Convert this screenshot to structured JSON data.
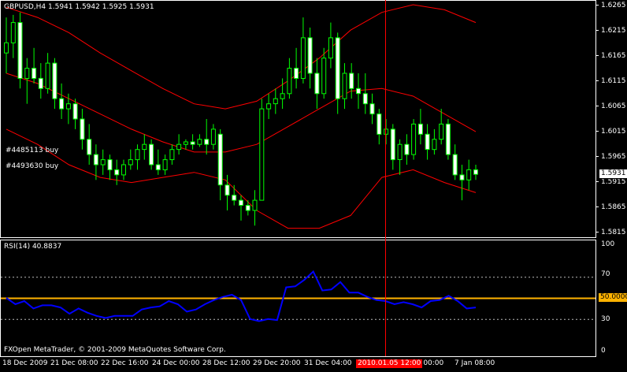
{
  "main_chart": {
    "header": "GBPUSD,H4  1.5941 1.5942 1.5925 1.5931",
    "orders": [
      "#4485113 buy",
      "#4493630 buy"
    ],
    "price_axis": [
      "1.6265",
      "1.6215",
      "1.6165",
      "1.6115",
      "1.6065",
      "1.6015",
      "1.5965",
      "1.5915",
      "1.5865",
      "1.5815"
    ],
    "current_price": "1.5931"
  },
  "rsi_panel": {
    "label": "RSI(14) 40.8837",
    "axis": [
      "100",
      "70",
      "30",
      "0"
    ],
    "level_value": "50.0000",
    "copyright": "FXOpen MetaTrader, © 2001-2009 MetaQuotes Software Corp."
  },
  "time_axis": {
    "labels": [
      "18 Dec 2009",
      "21 Dec 08:00",
      "22 Dec 16:00",
      "24 Dec 00:00",
      "28 Dec 12:00",
      "29 Dec 20:00",
      "31 Dec 04:00",
      "5 Jan 00:00",
      "7 Jan 08:00"
    ],
    "crosshair_time": "2010.01.05 12:00"
  },
  "colors": {
    "background": "#000000",
    "bull_candle": "#ffffff",
    "bear_candle": "#ffffff",
    "wick": "#00ff00",
    "bollinger": "#ff0000",
    "rsi_line": "#0000ff",
    "rsi_level": "#ffb300",
    "crosshair": "#ff0000",
    "axis": "#ffffff"
  },
  "chart_data": {
    "type": "candlestick",
    "symbol": "GBPUSD",
    "timeframe": "H4",
    "price_range": [
      1.5815,
      1.6265
    ],
    "candles": [
      {
        "o": 1.617,
        "h": 1.624,
        "l": 1.613,
        "c": 1.619
      },
      {
        "o": 1.619,
        "h": 1.6245,
        "l": 1.616,
        "c": 1.623
      },
      {
        "o": 1.623,
        "h": 1.625,
        "l": 1.61,
        "c": 1.612
      },
      {
        "o": 1.612,
        "h": 1.616,
        "l": 1.607,
        "c": 1.614
      },
      {
        "o": 1.614,
        "h": 1.618,
        "l": 1.611,
        "c": 1.612
      },
      {
        "o": 1.612,
        "h": 1.615,
        "l": 1.608,
        "c": 1.61
      },
      {
        "o": 1.61,
        "h": 1.617,
        "l": 1.609,
        "c": 1.615
      },
      {
        "o": 1.615,
        "h": 1.616,
        "l": 1.606,
        "c": 1.608
      },
      {
        "o": 1.608,
        "h": 1.611,
        "l": 1.604,
        "c": 1.606
      },
      {
        "o": 1.606,
        "h": 1.609,
        "l": 1.603,
        "c": 1.607
      },
      {
        "o": 1.607,
        "h": 1.608,
        "l": 1.602,
        "c": 1.604
      },
      {
        "o": 1.604,
        "h": 1.606,
        "l": 1.598,
        "c": 1.6
      },
      {
        "o": 1.6,
        "h": 1.603,
        "l": 1.595,
        "c": 1.597
      },
      {
        "o": 1.597,
        "h": 1.599,
        "l": 1.592,
        "c": 1.595
      },
      {
        "o": 1.595,
        "h": 1.598,
        "l": 1.593,
        "c": 1.596
      },
      {
        "o": 1.596,
        "h": 1.597,
        "l": 1.592,
        "c": 1.594
      },
      {
        "o": 1.594,
        "h": 1.596,
        "l": 1.591,
        "c": 1.593
      },
      {
        "o": 1.593,
        "h": 1.596,
        "l": 1.592,
        "c": 1.595
      },
      {
        "o": 1.595,
        "h": 1.598,
        "l": 1.594,
        "c": 1.596
      },
      {
        "o": 1.596,
        "h": 1.599,
        "l": 1.594,
        "c": 1.598
      },
      {
        "o": 1.598,
        "h": 1.601,
        "l": 1.596,
        "c": 1.599
      },
      {
        "o": 1.599,
        "h": 1.6,
        "l": 1.594,
        "c": 1.595
      },
      {
        "o": 1.595,
        "h": 1.598,
        "l": 1.593,
        "c": 1.594
      },
      {
        "o": 1.594,
        "h": 1.597,
        "l": 1.593,
        "c": 1.596
      },
      {
        "o": 1.596,
        "h": 1.599,
        "l": 1.595,
        "c": 1.598
      },
      {
        "o": 1.598,
        "h": 1.601,
        "l": 1.597,
        "c": 1.599
      },
      {
        "o": 1.599,
        "h": 1.6,
        "l": 1.598,
        "c": 1.5995
      },
      {
        "o": 1.5995,
        "h": 1.601,
        "l": 1.598,
        "c": 1.599
      },
      {
        "o": 1.599,
        "h": 1.601,
        "l": 1.5985,
        "c": 1.6
      },
      {
        "o": 1.6,
        "h": 1.604,
        "l": 1.597,
        "c": 1.599
      },
      {
        "o": 1.599,
        "h": 1.603,
        "l": 1.598,
        "c": 1.602
      },
      {
        "o": 1.601,
        "h": 1.602,
        "l": 1.588,
        "c": 1.591
      },
      {
        "o": 1.591,
        "h": 1.593,
        "l": 1.586,
        "c": 1.589
      },
      {
        "o": 1.589,
        "h": 1.591,
        "l": 1.587,
        "c": 1.588
      },
      {
        "o": 1.588,
        "h": 1.589,
        "l": 1.584,
        "c": 1.587
      },
      {
        "o": 1.587,
        "h": 1.588,
        "l": 1.585,
        "c": 1.586
      },
      {
        "o": 1.586,
        "h": 1.59,
        "l": 1.583,
        "c": 1.588
      },
      {
        "o": 1.588,
        "h": 1.608,
        "l": 1.588,
        "c": 1.606
      },
      {
        "o": 1.606,
        "h": 1.609,
        "l": 1.604,
        "c": 1.607
      },
      {
        "o": 1.607,
        "h": 1.61,
        "l": 1.605,
        "c": 1.608
      },
      {
        "o": 1.608,
        "h": 1.612,
        "l": 1.606,
        "c": 1.609
      },
      {
        "o": 1.609,
        "h": 1.616,
        "l": 1.608,
        "c": 1.614
      },
      {
        "o": 1.614,
        "h": 1.618,
        "l": 1.61,
        "c": 1.612
      },
      {
        "o": 1.612,
        "h": 1.624,
        "l": 1.611,
        "c": 1.62
      },
      {
        "o": 1.62,
        "h": 1.622,
        "l": 1.61,
        "c": 1.613
      },
      {
        "o": 1.613,
        "h": 1.616,
        "l": 1.606,
        "c": 1.609
      },
      {
        "o": 1.609,
        "h": 1.618,
        "l": 1.608,
        "c": 1.616
      },
      {
        "o": 1.616,
        "h": 1.623,
        "l": 1.614,
        "c": 1.62
      },
      {
        "o": 1.62,
        "h": 1.621,
        "l": 1.605,
        "c": 1.608
      },
      {
        "o": 1.608,
        "h": 1.615,
        "l": 1.606,
        "c": 1.613
      },
      {
        "o": 1.613,
        "h": 1.615,
        "l": 1.608,
        "c": 1.61
      },
      {
        "o": 1.61,
        "h": 1.613,
        "l": 1.606,
        "c": 1.609
      },
      {
        "o": 1.609,
        "h": 1.613,
        "l": 1.605,
        "c": 1.607
      },
      {
        "o": 1.607,
        "h": 1.609,
        "l": 1.603,
        "c": 1.605
      },
      {
        "o": 1.605,
        "h": 1.606,
        "l": 1.599,
        "c": 1.601
      },
      {
        "o": 1.601,
        "h": 1.604,
        "l": 1.599,
        "c": 1.602
      },
      {
        "o": 1.602,
        "h": 1.603,
        "l": 1.594,
        "c": 1.596
      },
      {
        "o": 1.596,
        "h": 1.6,
        "l": 1.593,
        "c": 1.599
      },
      {
        "o": 1.599,
        "h": 1.601,
        "l": 1.595,
        "c": 1.597
      },
      {
        "o": 1.597,
        "h": 1.604,
        "l": 1.596,
        "c": 1.603
      },
      {
        "o": 1.603,
        "h": 1.606,
        "l": 1.599,
        "c": 1.601
      },
      {
        "o": 1.601,
        "h": 1.603,
        "l": 1.596,
        "c": 1.598
      },
      {
        "o": 1.598,
        "h": 1.602,
        "l": 1.597,
        "c": 1.6
      },
      {
        "o": 1.6,
        "h": 1.606,
        "l": 1.599,
        "c": 1.603
      },
      {
        "o": 1.603,
        "h": 1.604,
        "l": 1.596,
        "c": 1.597
      },
      {
        "o": 1.597,
        "h": 1.599,
        "l": 1.592,
        "c": 1.593
      },
      {
        "o": 1.593,
        "h": 1.595,
        "l": 1.588,
        "c": 1.592
      },
      {
        "o": 1.592,
        "h": 1.596,
        "l": 1.59,
        "c": 1.594
      },
      {
        "o": 1.594,
        "h": 1.595,
        "l": 1.592,
        "c": 1.5931
      }
    ],
    "bollinger_upper": [
      1.626,
      1.624,
      1.621,
      1.617,
      1.6135,
      1.61,
      1.607,
      1.606,
      1.6075,
      1.6115,
      1.616,
      1.6215,
      1.625,
      1.6265,
      1.6255,
      1.623
    ],
    "bollinger_middle": [
      1.613,
      1.611,
      1.608,
      1.605,
      1.602,
      1.5995,
      1.5975,
      1.5975,
      1.599,
      1.6025,
      1.606,
      1.6095,
      1.61,
      1.6085,
      1.605,
      1.6015
    ],
    "bollinger_lower": [
      1.602,
      1.599,
      1.595,
      1.5925,
      1.5915,
      1.5925,
      1.5935,
      1.592,
      1.586,
      1.5825,
      1.5825,
      1.585,
      1.5925,
      1.594,
      1.5915,
      1.5895
    ],
    "rsi": [
      50,
      44,
      47,
      40,
      43,
      43,
      41,
      35,
      40,
      36,
      33,
      31,
      33,
      33,
      33,
      39,
      41,
      42,
      47,
      44,
      37,
      39,
      44,
      48,
      51,
      53,
      48,
      30,
      28,
      30,
      29,
      60,
      61,
      67,
      75,
      57,
      58,
      65,
      55,
      55,
      51,
      48,
      47,
      44,
      46,
      44,
      41,
      47,
      48,
      52,
      47,
      40,
      41
    ],
    "rsi_levels": [
      70,
      50,
      30
    ],
    "rsi_range": [
      0,
      100
    ]
  }
}
